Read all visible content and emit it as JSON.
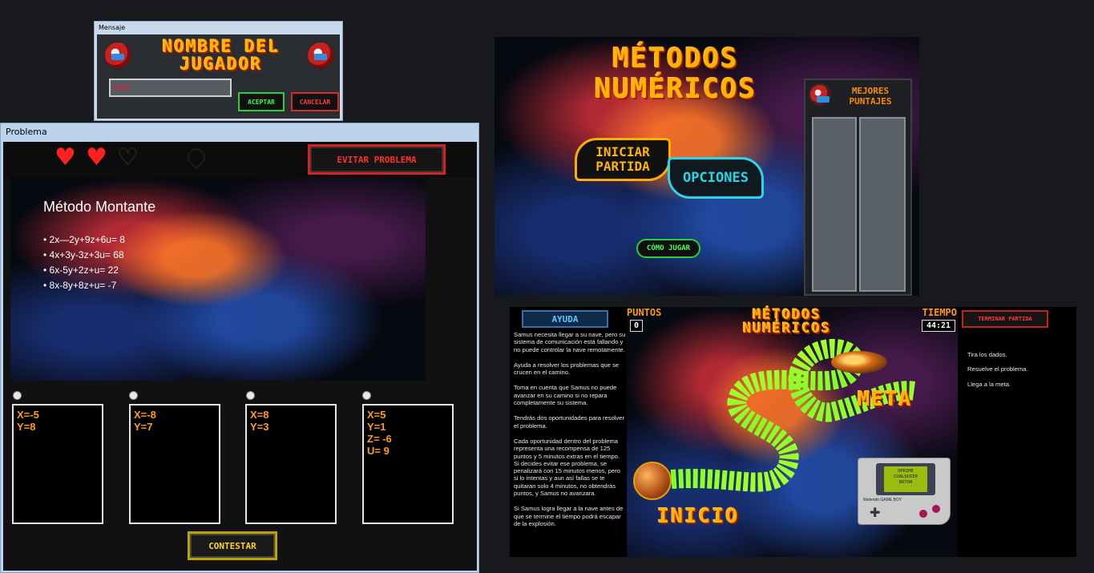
{
  "dialog": {
    "window_title": "Mensaje",
    "heading_line1": "NOMBRE DEL",
    "heading_line2": "JUGADOR",
    "name_value": "erre",
    "accept_label": "ACEPTAR",
    "cancel_label": "CANCELAR"
  },
  "problem_window": {
    "window_title": "Problema",
    "lives": [
      true,
      true,
      false
    ],
    "avoid_label": "EVITAR PROBLEMA",
    "method_title": "Método Montante",
    "equations": [
      "2x—2y+9z+6u= 8",
      "4x+3y-3z+3u= 68",
      "6x-5y+2z+u= 22",
      "8x-8y+8z+u= -7"
    ],
    "answers": [
      [
        "X=-5",
        "Y=8"
      ],
      [
        "X=-8",
        "Y=7"
      ],
      [
        "X=8",
        "Y=3"
      ],
      [
        "X=5",
        "Y=1",
        "Z= -6",
        "U= 9"
      ]
    ],
    "answer_button": "CONTESTAR"
  },
  "menu": {
    "title_line1": "MÉTODOS",
    "title_line2": "NUMÉRICOS",
    "start_line1": "INICIAR",
    "start_line2": "PARTIDA",
    "options_label": "OPCIONES",
    "howto_label": "CÓMO JUGAR",
    "scores_line1": "MEJORES",
    "scores_line2": "PUNTAJES"
  },
  "board": {
    "help_label": "AYUDA",
    "points_label": "PUNTOS",
    "points_value": "0",
    "title_line1": "MÉTODOS",
    "title_line2": "NUMÉRICOS",
    "time_label": "TIEMPO",
    "time_value": "44:21",
    "end_label": "TERMINAR PARTIDA",
    "meta_label": "META",
    "inicio_label": "INICIO",
    "story": [
      "Samus necesita llegar a su nave, pero su sistema de comunicación está fallando y no puede controlar la nave remotamente.",
      "Ayuda a resolver los problemas que se crucen en el camino.",
      "Toma en cuenta que Samus no puede avanzar en su camino si no repara completamente su sistema.",
      "Tendrás dos oportunidades para resolver el problema.",
      "Cada oportunidad dentro del problema representa una recompensa de 125 puntos y 5 minutos extras en el tiempo. Si decides evitar ese problema, se penalizará con 15 minutos menos, pero si lo intentas y aun así fallas se te quitaran solo 4 minutos, no obtendrás puntos, y Samus no avanzara.",
      "Si Samus logra llegar a la nave antes de que se termine el tiempo podrá escapar de la explosión."
    ],
    "steps": [
      "Tira los dados.",
      "Resuelve el problema.",
      "Llega a la meta."
    ],
    "gameboy_screen": [
      "OPRIME",
      "CUALQUIER",
      "BOTON"
    ],
    "gameboy_brand": "Nintendo GAME BOY"
  }
}
